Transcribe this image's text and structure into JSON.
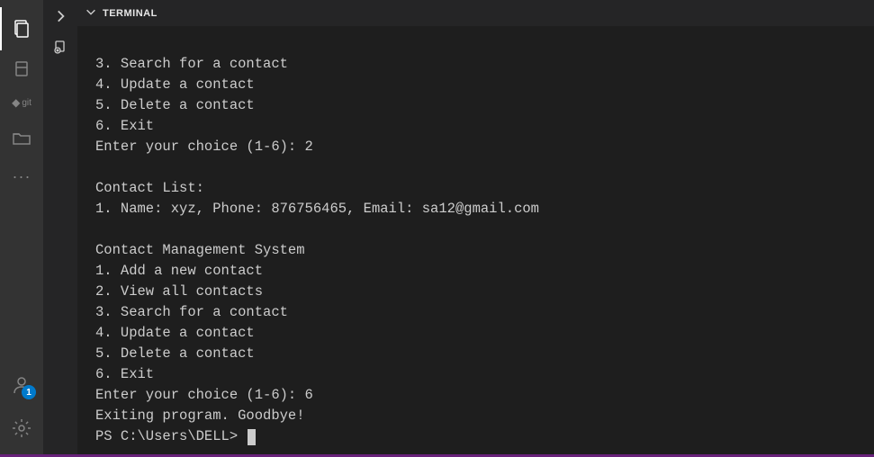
{
  "activityBar": {
    "accountBadge": "1",
    "gitLabel": "git"
  },
  "panel": {
    "title": "TERMINAL"
  },
  "terminal": {
    "lines": [
      "3. Search for a contact",
      "4. Update a contact",
      "5. Delete a contact",
      "6. Exit",
      "Enter your choice (1-6): 2",
      "",
      "Contact List:",
      "1. Name: xyz, Phone: 876756465, Email: sa12@gmail.com",
      "",
      "Contact Management System",
      "1. Add a new contact",
      "2. View all contacts",
      "3. Search for a contact",
      "4. Update a contact",
      "5. Delete a contact",
      "6. Exit",
      "Enter your choice (1-6): 6",
      "Exiting program. Goodbye!"
    ],
    "prompt": "PS C:\\Users\\DELL> "
  }
}
